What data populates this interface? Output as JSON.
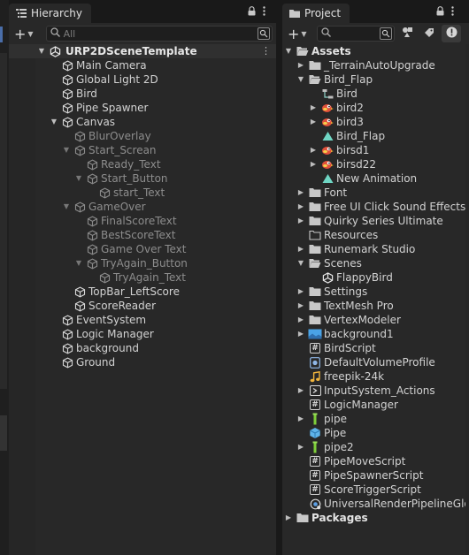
{
  "hierarchy": {
    "tab_label": "Hierarchy",
    "search_placeholder": "All",
    "scene_name": "URP2DSceneTemplate",
    "items": [
      {
        "label": "Main Camera",
        "depth": 1,
        "arrow": "",
        "dim": false,
        "icon": "cube-icon"
      },
      {
        "label": "Global Light 2D",
        "depth": 1,
        "arrow": "",
        "dim": false,
        "icon": "cube-icon"
      },
      {
        "label": "Bird",
        "depth": 1,
        "arrow": "",
        "dim": false,
        "icon": "cube-icon"
      },
      {
        "label": "Pipe Spawner",
        "depth": 1,
        "arrow": "",
        "dim": false,
        "icon": "cube-icon"
      },
      {
        "label": "Canvas",
        "depth": 1,
        "arrow": "expanded",
        "dim": false,
        "icon": "cube-icon"
      },
      {
        "label": "BlurOverlay",
        "depth": 2,
        "arrow": "",
        "dim": true,
        "icon": "cube-icon"
      },
      {
        "label": "Start_Screan",
        "depth": 2,
        "arrow": "expanded",
        "dim": true,
        "icon": "cube-icon"
      },
      {
        "label": "Ready_Text",
        "depth": 3,
        "arrow": "",
        "dim": true,
        "icon": "cube-icon"
      },
      {
        "label": "Start_Button",
        "depth": 3,
        "arrow": "expanded",
        "dim": true,
        "icon": "cube-icon"
      },
      {
        "label": "start_Text",
        "depth": 4,
        "arrow": "",
        "dim": true,
        "icon": "cube-icon"
      },
      {
        "label": "GameOver",
        "depth": 2,
        "arrow": "expanded",
        "dim": true,
        "icon": "cube-icon"
      },
      {
        "label": "FinalScoreText",
        "depth": 3,
        "arrow": "",
        "dim": true,
        "icon": "cube-icon"
      },
      {
        "label": "BestScoreText",
        "depth": 3,
        "arrow": "",
        "dim": true,
        "icon": "cube-icon"
      },
      {
        "label": "Game Over Text",
        "depth": 3,
        "arrow": "",
        "dim": true,
        "icon": "cube-icon"
      },
      {
        "label": "TryAgain_Button",
        "depth": 3,
        "arrow": "expanded",
        "dim": true,
        "icon": "cube-icon"
      },
      {
        "label": "TryAgain_Text",
        "depth": 4,
        "arrow": "",
        "dim": true,
        "icon": "cube-icon"
      },
      {
        "label": "TopBar_LeftScore",
        "depth": 2,
        "arrow": "",
        "dim": false,
        "icon": "cube-icon"
      },
      {
        "label": "ScoreReader",
        "depth": 2,
        "arrow": "",
        "dim": false,
        "icon": "cube-icon"
      },
      {
        "label": "EventSystem",
        "depth": 1,
        "arrow": "",
        "dim": false,
        "icon": "cube-icon"
      },
      {
        "label": "Logic Manager",
        "depth": 1,
        "arrow": "",
        "dim": false,
        "icon": "cube-icon"
      },
      {
        "label": "background",
        "depth": 1,
        "arrow": "",
        "dim": false,
        "icon": "cube-icon"
      },
      {
        "label": "Ground",
        "depth": 1,
        "arrow": "",
        "dim": false,
        "icon": "cube-icon"
      }
    ]
  },
  "project": {
    "tab_label": "Project",
    "search_placeholder": "",
    "items": [
      {
        "label": "Assets",
        "depth": 0,
        "arrow": "expanded",
        "icon": "folder-open-icon",
        "bold": true
      },
      {
        "label": "_TerrainAutoUpgrade",
        "depth": 1,
        "arrow": "collapsed",
        "icon": "folder-icon"
      },
      {
        "label": "Bird_Flap",
        "depth": 1,
        "arrow": "expanded",
        "icon": "folder-open-icon"
      },
      {
        "label": "Bird",
        "depth": 2,
        "arrow": "",
        "icon": "animator-icon"
      },
      {
        "label": "bird2",
        "depth": 2,
        "arrow": "collapsed",
        "icon": "bird-sprite-icon"
      },
      {
        "label": "bird3",
        "depth": 2,
        "arrow": "collapsed",
        "icon": "bird-sprite-icon"
      },
      {
        "label": "Bird_Flap",
        "depth": 2,
        "arrow": "",
        "icon": "animation-clip-icon"
      },
      {
        "label": "birsd1",
        "depth": 2,
        "arrow": "collapsed",
        "icon": "bird-sprite-icon"
      },
      {
        "label": "birsd22",
        "depth": 2,
        "arrow": "collapsed",
        "icon": "bird-sprite-icon"
      },
      {
        "label": "New Animation",
        "depth": 2,
        "arrow": "",
        "icon": "animation-clip-icon"
      },
      {
        "label": "Font",
        "depth": 1,
        "arrow": "collapsed",
        "icon": "folder-icon"
      },
      {
        "label": "Free UI Click Sound Effects P",
        "depth": 1,
        "arrow": "collapsed",
        "icon": "folder-icon"
      },
      {
        "label": "Quirky Series Ultimate",
        "depth": 1,
        "arrow": "collapsed",
        "icon": "folder-icon"
      },
      {
        "label": "Resources",
        "depth": 1,
        "arrow": "",
        "icon": "folder-empty-icon"
      },
      {
        "label": "Runemark Studio",
        "depth": 1,
        "arrow": "collapsed",
        "icon": "folder-icon"
      },
      {
        "label": "Scenes",
        "depth": 1,
        "arrow": "expanded",
        "icon": "folder-open-icon"
      },
      {
        "label": "FlappyBird",
        "depth": 2,
        "arrow": "",
        "icon": "unity-scene-icon"
      },
      {
        "label": "Settings",
        "depth": 1,
        "arrow": "collapsed",
        "icon": "folder-icon"
      },
      {
        "label": "TextMesh Pro",
        "depth": 1,
        "arrow": "collapsed",
        "icon": "folder-icon"
      },
      {
        "label": "VertexModeler",
        "depth": 1,
        "arrow": "collapsed",
        "icon": "folder-icon"
      },
      {
        "label": "background1",
        "depth": 1,
        "arrow": "collapsed",
        "icon": "image-sprite-icon"
      },
      {
        "label": "BirdScript",
        "depth": 1,
        "arrow": "",
        "icon": "csharp-script-icon"
      },
      {
        "label": "DefaultVolumeProfile",
        "depth": 1,
        "arrow": "",
        "icon": "volume-profile-icon"
      },
      {
        "label": "freepik-24k",
        "depth": 1,
        "arrow": "",
        "icon": "audio-clip-icon"
      },
      {
        "label": "InputSystem_Actions",
        "depth": 1,
        "arrow": "collapsed",
        "icon": "input-actions-icon"
      },
      {
        "label": "LogicManager",
        "depth": 1,
        "arrow": "",
        "icon": "csharp-script-icon"
      },
      {
        "label": "pipe",
        "depth": 1,
        "arrow": "collapsed",
        "icon": "pipe-sprite-icon"
      },
      {
        "label": "Pipe",
        "depth": 1,
        "arrow": "",
        "icon": "prefab-icon"
      },
      {
        "label": "pipe2",
        "depth": 1,
        "arrow": "collapsed",
        "icon": "pipe-sprite-icon"
      },
      {
        "label": "PipeMoveScript",
        "depth": 1,
        "arrow": "",
        "icon": "csharp-script-icon"
      },
      {
        "label": "PipeSpawnerScript",
        "depth": 1,
        "arrow": "",
        "icon": "csharp-script-icon"
      },
      {
        "label": "ScoreTriggerScript",
        "depth": 1,
        "arrow": "",
        "icon": "csharp-script-icon"
      },
      {
        "label": "UniversalRenderPipelineGlob",
        "depth": 1,
        "arrow": "",
        "icon": "render-pipeline-asset-icon"
      },
      {
        "label": "Packages",
        "depth": 0,
        "arrow": "collapsed",
        "icon": "folder-icon",
        "bold": true
      }
    ]
  }
}
